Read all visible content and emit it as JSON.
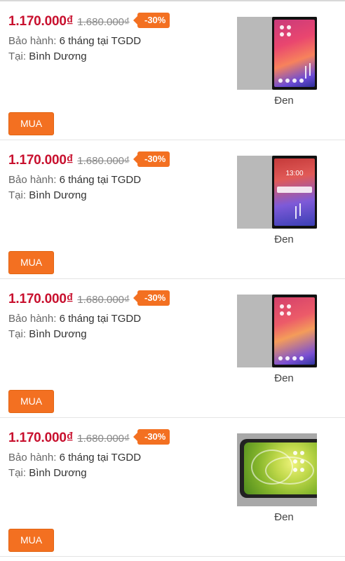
{
  "products": [
    {
      "price": "1.170.000₫",
      "old_price": "1.680.000₫",
      "discount": "-30%",
      "warranty_label": "Bảo hành:",
      "warranty_value": "6 tháng tại TGDD",
      "location_label": "Tại:",
      "location_value": "Bình Dương",
      "buy_label": "MUA",
      "color_name": "Đen",
      "image": "phone-home-screen"
    },
    {
      "price": "1.170.000₫",
      "old_price": "1.680.000₫",
      "discount": "-30%",
      "warranty_label": "Bảo hành:",
      "warranty_value": "6 tháng tại TGDD",
      "location_label": "Tại:",
      "location_value": "Bình Dương",
      "buy_label": "MUA",
      "color_name": "Đen",
      "image": "phone-lock-screen",
      "screen_clock": "13:00"
    },
    {
      "price": "1.170.000₫",
      "old_price": "1.680.000₫",
      "discount": "-30%",
      "warranty_label": "Bảo hành:",
      "warranty_value": "6 tháng tại TGDD",
      "location_label": "Tại:",
      "location_value": "Bình Dương",
      "buy_label": "MUA",
      "color_name": "Đen",
      "image": "phone-home-screen"
    },
    {
      "price": "1.170.000₫",
      "old_price": "1.680.000₫",
      "discount": "-30%",
      "warranty_label": "Bảo hành:",
      "warranty_value": "6 tháng tại TGDD",
      "location_label": "Tại:",
      "location_value": "Bình Dương",
      "buy_label": "MUA",
      "color_name": "Đen",
      "image": "phone-green-wallpaper"
    }
  ],
  "colors": {
    "price": "#c8102e",
    "accent": "#f37021",
    "old_price": "#888888"
  }
}
